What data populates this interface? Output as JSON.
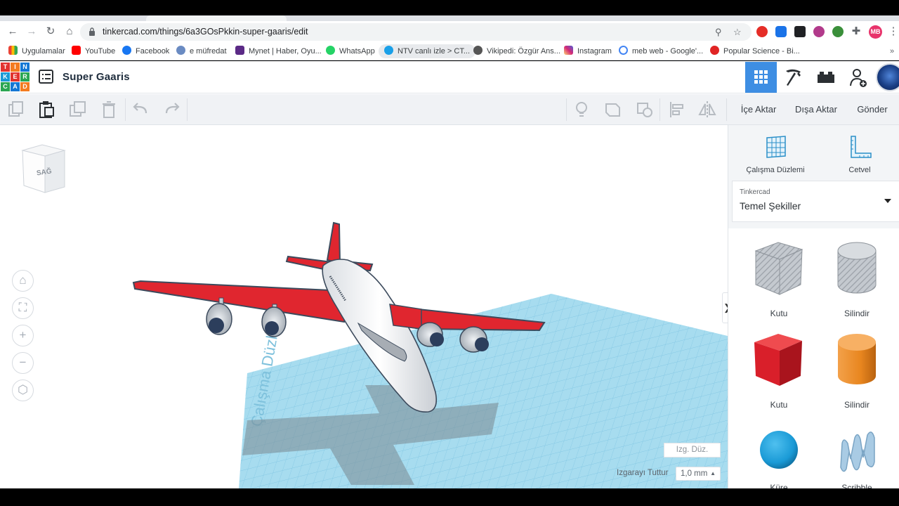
{
  "browser": {
    "url": "tinkercad.com/things/6a3GOsPkkin-super-gaaris/edit",
    "profile_initials": "MB",
    "bookmarks": [
      "Uygulamalar",
      "YouTube",
      "Facebook",
      "e müfredat",
      "Mynet | Haber, Oyu...",
      "WhatsApp",
      "NTV canlı izle > CT...",
      "Vikipedi: Özgür Ans...",
      "Instagram",
      "meb web - Google'...",
      "Popular Science - Bi..."
    ]
  },
  "app": {
    "logo_letters": [
      "T",
      "I",
      "N",
      "K",
      "E",
      "R",
      "C",
      "A",
      "D"
    ],
    "project_title": "Super Gaaris"
  },
  "toolbar": {
    "import_label": "İçe Aktar",
    "export_label": "Dışa Aktar",
    "send_label": "Gönder"
  },
  "workplane": {
    "viewcube_label": "SAĞ",
    "plane_watermark": "Çalışma Düzlemi",
    "edit_grid_label": "Izg. Düz.",
    "snap_grid_label": "Izgarayı Tuttur",
    "snap_grid_value": "1,0 mm"
  },
  "sidebar": {
    "tool_workplane": "Çalışma Düzlemi",
    "tool_ruler": "Cetvel",
    "library_small": "Tinkercad",
    "library_name": "Temel Şekiller",
    "shapes": [
      {
        "label": "Kutu"
      },
      {
        "label": "Silindir"
      },
      {
        "label": "Kutu"
      },
      {
        "label": "Silindir"
      },
      {
        "label": "Küre"
      },
      {
        "label": "Scribble"
      }
    ]
  },
  "colors": {
    "accent": "#3e8ee3",
    "plane_red": "#e0262f",
    "grid_blue": "#9fd8ee",
    "shape_red": "#d91f2a",
    "shape_orange": "#e8861f",
    "shape_blue": "#1a9ad6"
  }
}
